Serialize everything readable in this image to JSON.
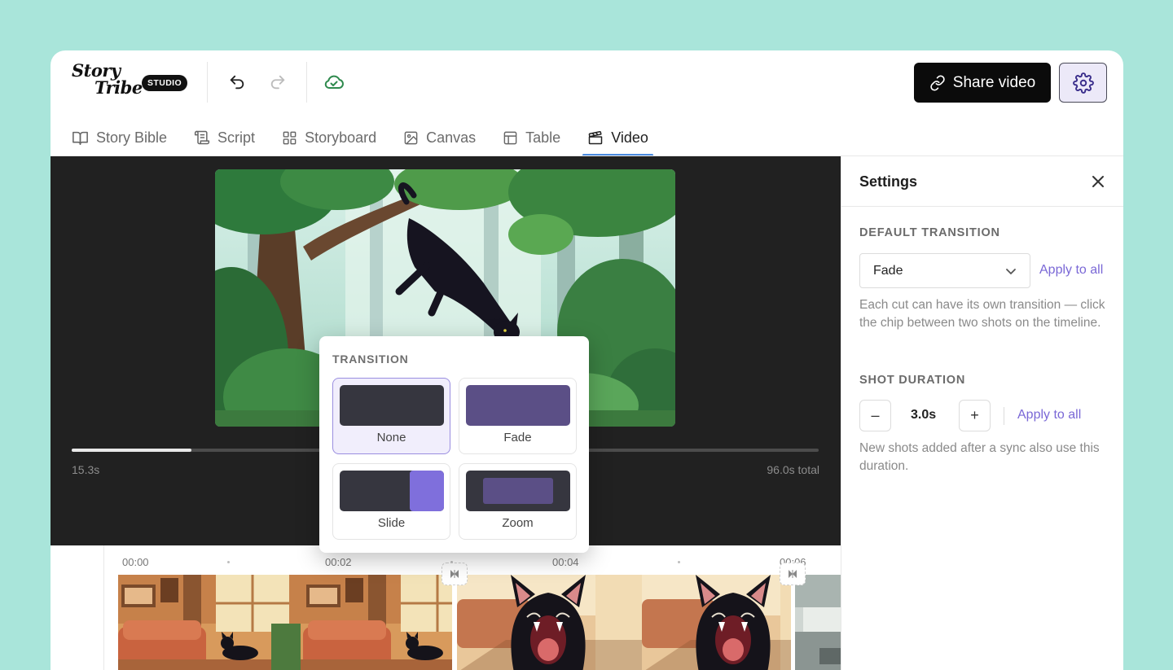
{
  "brand": {
    "line1": "Story",
    "line2": "Tribe",
    "badge": "STUDIO"
  },
  "toolbar": {
    "undo_icon": "undo-icon",
    "redo_icon": "redo-icon",
    "sync_icon": "cloud-check-icon"
  },
  "header": {
    "share_label": "Share video",
    "settings_icon": "gear-icon"
  },
  "tabs": [
    {
      "label": "Story Bible",
      "icon": "book-icon"
    },
    {
      "label": "Script",
      "icon": "scroll-icon"
    },
    {
      "label": "Storyboard",
      "icon": "grid-icon"
    },
    {
      "label": "Canvas",
      "icon": "image-icon"
    },
    {
      "label": "Table",
      "icon": "table-icon"
    },
    {
      "label": "Video",
      "icon": "clapperboard-icon",
      "active": true
    }
  ],
  "player": {
    "current_time": "15.3s",
    "total_time": "96.0s total",
    "progress_fraction": 0.16
  },
  "transition_popover": {
    "title": "TRANSITION",
    "options": [
      {
        "label": "None",
        "selected": true
      },
      {
        "label": "Fade",
        "selected": false
      },
      {
        "label": "Slide",
        "selected": false
      },
      {
        "label": "Zoom",
        "selected": false
      }
    ]
  },
  "timeline": {
    "labels": [
      "00:00",
      "00:02",
      "00:04",
      "00:06"
    ]
  },
  "settings": {
    "title": "Settings",
    "default_transition_label": "DEFAULT TRANSITION",
    "default_transition_value": "Fade",
    "apply_all_1": "Apply to all",
    "transition_hint": "Each cut can have its own transition — click the chip between two shots on the timeline.",
    "shot_duration_label": "SHOT DURATION",
    "duration_value": "3.0s",
    "minus": "–",
    "plus": "+",
    "apply_all_2": "Apply to all",
    "duration_hint": "New shots added after a sync also use this duration."
  },
  "colors": {
    "accent": "#7a68d6",
    "tab_underline": "#4a8be0",
    "background": "#a9e5da",
    "preview_bg": "#212121"
  }
}
